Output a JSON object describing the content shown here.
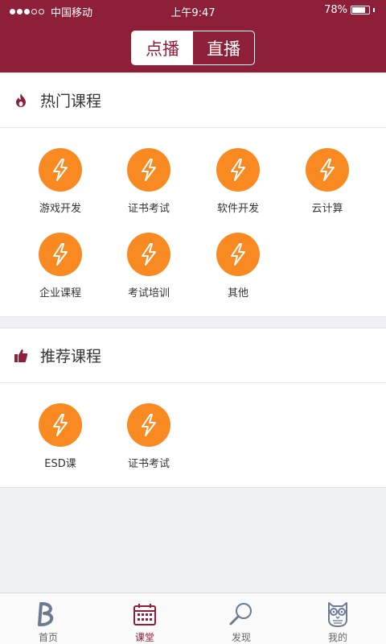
{
  "status_bar": {
    "carrier": "中国移动",
    "time": "上午9:47",
    "battery": "78%",
    "battery_level": 0.78
  },
  "segment": {
    "on_demand": "点播",
    "live": "直播",
    "selected": "点播"
  },
  "hot": {
    "title": "热门课程",
    "items": [
      {
        "label": "游戏开发",
        "icon": "lightning-icon"
      },
      {
        "label": "证书考试",
        "icon": "lightning-icon"
      },
      {
        "label": "软件开发",
        "icon": "lightning-icon"
      },
      {
        "label": "云计算",
        "icon": "lightning-icon"
      },
      {
        "label": "企业课程",
        "icon": "lightning-icon"
      },
      {
        "label": "考试培训",
        "icon": "lightning-icon"
      },
      {
        "label": "其他",
        "icon": "lightning-icon"
      }
    ]
  },
  "recommend": {
    "title": "推荐课程",
    "items": [
      {
        "label": "ESD课",
        "icon": "lightning-icon"
      },
      {
        "label": "证书考试",
        "icon": "lightning-icon"
      }
    ]
  },
  "tabbar": {
    "items": [
      {
        "label": "首页",
        "icon": "logo-b-icon"
      },
      {
        "label": "课堂",
        "icon": "calendar-icon"
      },
      {
        "label": "发现",
        "icon": "magnifier-icon"
      },
      {
        "label": "我的",
        "icon": "owl-icon"
      }
    ],
    "active": "课堂"
  },
  "colors": {
    "brand": "#8e1f38",
    "accent": "#f98a22",
    "background": "#f0f1f3"
  }
}
